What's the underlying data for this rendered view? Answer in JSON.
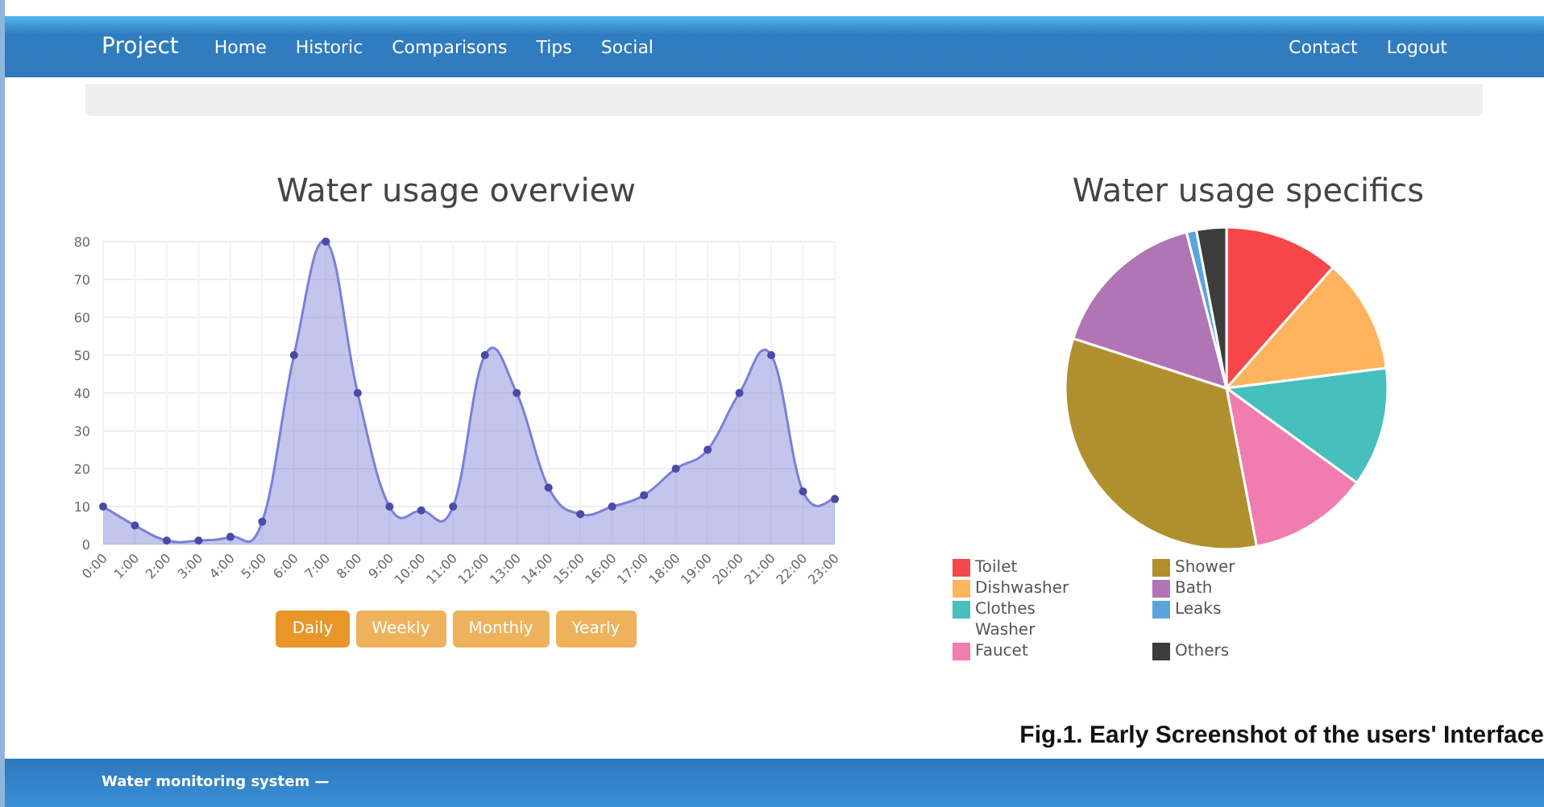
{
  "navbar": {
    "brand": "Project",
    "items": [
      "Home",
      "Historic",
      "Comparisons",
      "Tips",
      "Social"
    ],
    "right_items": [
      "Contact",
      "Logout"
    ]
  },
  "overview": {
    "title": "Water usage overview",
    "chart_data": {
      "type": "area",
      "categories": [
        "0:00",
        "1:00",
        "2:00",
        "3:00",
        "4:00",
        "5:00",
        "6:00",
        "7:00",
        "8:00",
        "9:00",
        "10:00",
        "11:00",
        "12:00",
        "13:00",
        "14:00",
        "15:00",
        "16:00",
        "17:00",
        "18:00",
        "19:00",
        "20:00",
        "21:00",
        "22:00",
        "23:00"
      ],
      "series": [
        {
          "color": "#7b7fd8",
          "values": [
            10,
            5,
            1,
            1,
            2,
            6,
            50,
            80,
            40,
            10,
            9,
            10,
            50,
            40,
            15,
            8,
            10,
            13,
            20,
            25,
            40,
            50,
            14,
            12
          ]
        }
      ],
      "ylim": [
        0,
        80
      ],
      "grid": true,
      "yticks": [
        0,
        10,
        20,
        30,
        40,
        50,
        60,
        70,
        80
      ]
    },
    "periods": [
      {
        "label": "Daily",
        "selected": true
      },
      {
        "label": "Weekly",
        "selected": false
      },
      {
        "label": "Monthly",
        "selected": false
      },
      {
        "label": "Yearly",
        "selected": false
      }
    ]
  },
  "specifics": {
    "title": "Water usage specifics",
    "legend": [
      {
        "label": "Toilet",
        "color": "#f7464a"
      },
      {
        "label": "Dishwasher",
        "color": "#fdb45c"
      },
      {
        "label": "Clothes Washer",
        "color": "#46bfbd"
      },
      {
        "label": "Faucet",
        "color": "#f07cb0"
      },
      {
        "label": "Shower",
        "color": "#b0902e"
      },
      {
        "label": "Bath",
        "color": "#b174b5"
      },
      {
        "label": "Leaks",
        "color": "#5aa6dc"
      },
      {
        "label": "Others",
        "color": "#3c3c3c"
      }
    ]
  },
  "caption": "Fig.1. Early Screenshot of the users' Interface",
  "footer": "Water monitoring system —"
}
